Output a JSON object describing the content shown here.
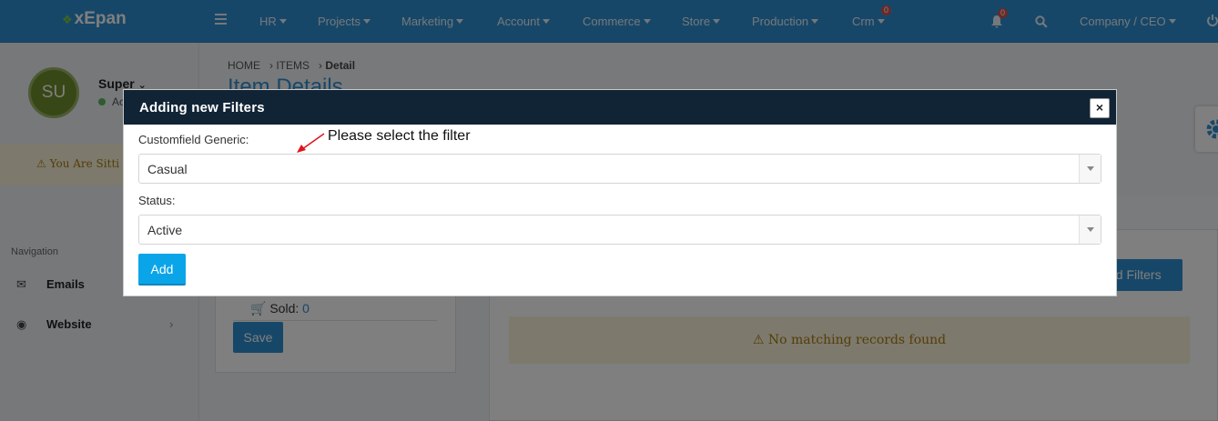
{
  "topbar": {
    "logo": "xEpan",
    "menu": [
      "HR",
      "Projects",
      "Marketing",
      "Account",
      "Commerce",
      "Store",
      "Production",
      "Crm"
    ],
    "crm_badge": "0",
    "notification_badge": "0",
    "user_menu": "Company / CEO"
  },
  "sidebar": {
    "avatar_initials": "SU",
    "username": "Super",
    "status": "Ac",
    "warning": "You Are Sitti",
    "nav_heading": "Navigation",
    "items": [
      {
        "label": "Emails",
        "icon": "envelope-icon"
      },
      {
        "label": "Website",
        "icon": "globe-icon"
      }
    ]
  },
  "main": {
    "breadcrumb": [
      "HOME",
      "ITEMS",
      "Detail"
    ],
    "page_title": "Item Details",
    "sold_label": "Sold:",
    "sold_value": "0",
    "save_label": "Save",
    "add_filters_label": "dd Filters",
    "no_records": "No matching records found"
  },
  "modal": {
    "title": "Adding new Filters",
    "close_label": "×",
    "field1_label": "Customfield Generic:",
    "field1_value": "Casual",
    "field2_label": "Status:",
    "field2_value": "Active",
    "add_label": "Add"
  },
  "annotation": {
    "text": "Please select the filter",
    "color": "#e0141e"
  },
  "colors": {
    "brand": "#2f8ed0",
    "modal_header": "#112436",
    "primary_button": "#0aa5e8"
  }
}
